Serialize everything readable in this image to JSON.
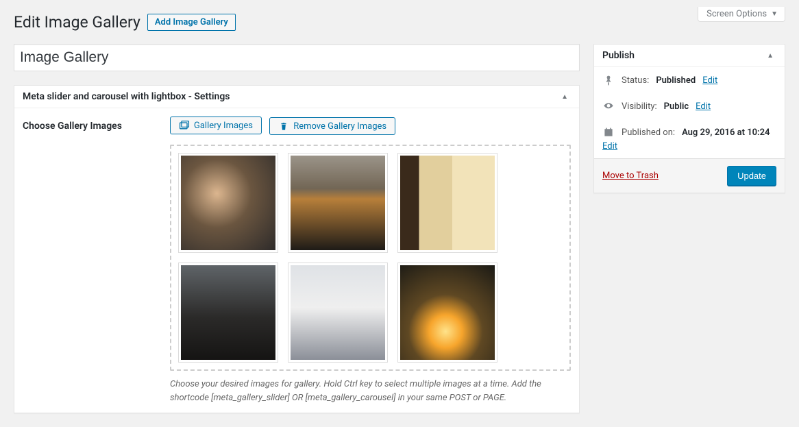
{
  "screen_options": {
    "label": "Screen Options"
  },
  "header": {
    "title": "Edit Image Gallery",
    "add_new_label": "Add Image Gallery"
  },
  "post_title": {
    "value": "Image Gallery"
  },
  "settings_box": {
    "title": "Meta slider and carousel with lightbox - Settings",
    "choose_label": "Choose Gallery Images",
    "gallery_images_btn": "Gallery Images",
    "remove_images_btn": "Remove Gallery Images",
    "description": "Choose your desired images for gallery. Hold Ctrl key to select multiple images at a time. Add the shortcode [meta_gallery_slider] OR [meta_gallery_carousel] in your same POST or PAGE.",
    "thumbnails": [
      "img-1",
      "img-2",
      "img-3",
      "img-4",
      "img-5",
      "img-6"
    ]
  },
  "publish": {
    "box_title": "Publish",
    "status_label": "Status:",
    "status_value": "Published",
    "visibility_label": "Visibility:",
    "visibility_value": "Public",
    "published_on_label": "Published on:",
    "published_on_value": "Aug 29, 2016 at 10:24",
    "edit_label": "Edit",
    "trash_label": "Move to Trash",
    "update_label": "Update"
  }
}
